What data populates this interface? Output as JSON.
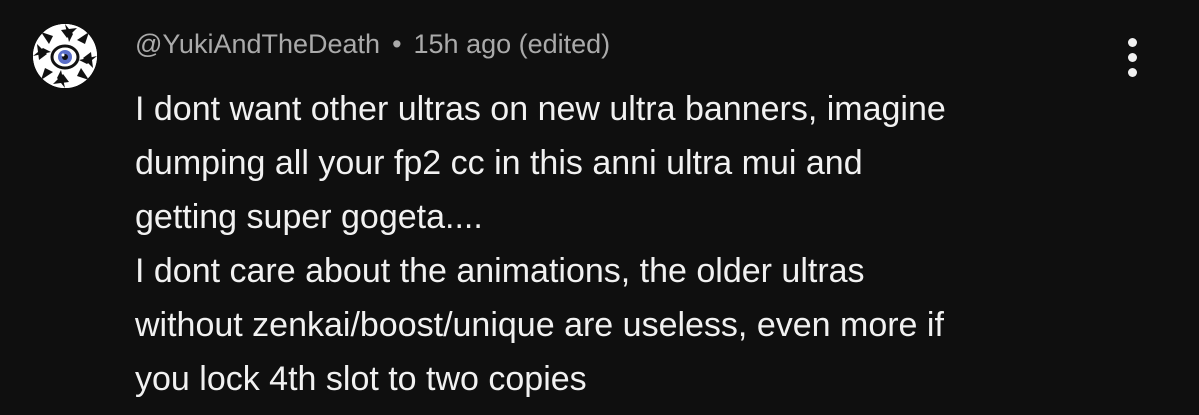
{
  "comment": {
    "author": "@YukiAndTheDeath",
    "separator": "•",
    "time": "15h ago (edited)",
    "lines": [
      "I dont want other ultras on new ultra banners, imagine",
      "dumping all your fp2 cc in this anni ultra mui and",
      "getting super gogeta....",
      "I dont care about the animations, the older ultras",
      "without zenkai/boost/unique are useless, even more if",
      "you lock 4th slot to two copies"
    ]
  },
  "icons": {
    "avatar": "avatar-image",
    "menu": "more-vert-icon"
  },
  "colors": {
    "background": "#0f0f0f",
    "text": "#f1f1f1",
    "meta": "#aaaaaa"
  }
}
